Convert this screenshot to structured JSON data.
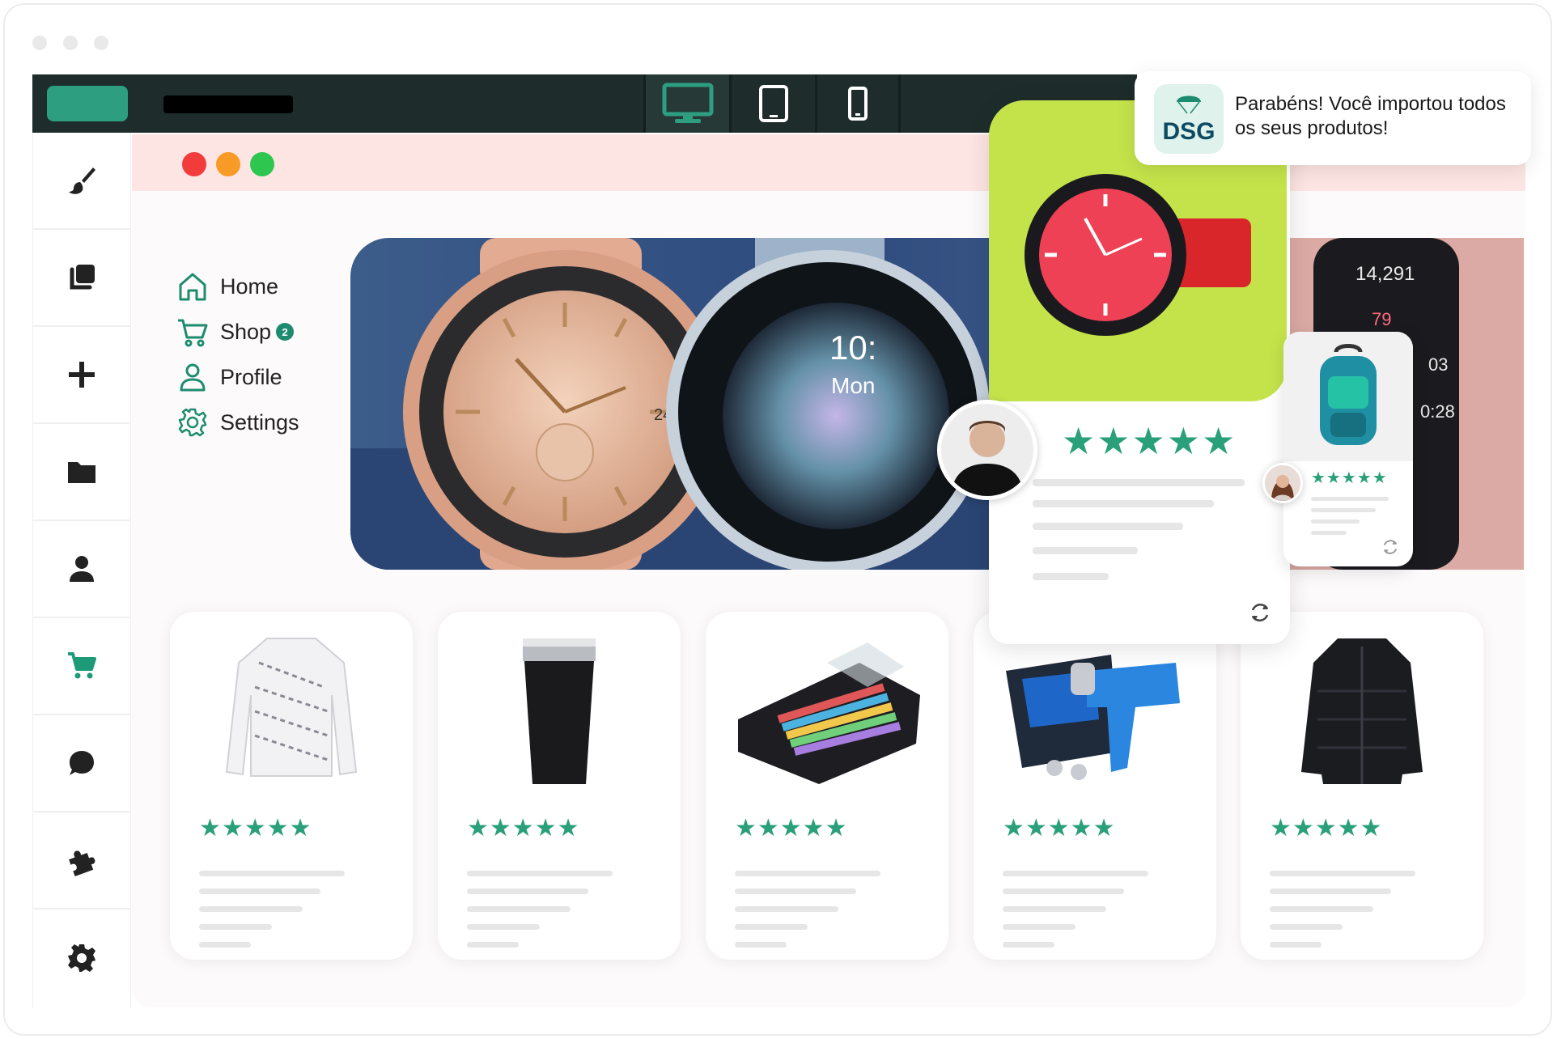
{
  "toolbar": {
    "devices": [
      "desktop",
      "tablet",
      "mobile"
    ],
    "active_device": "desktop",
    "accent": "#2e9e80"
  },
  "sidebar": {
    "items": [
      {
        "icon": "brush-icon"
      },
      {
        "icon": "copy-icon"
      },
      {
        "icon": "plus-icon"
      },
      {
        "icon": "folder-icon"
      },
      {
        "icon": "person-icon"
      },
      {
        "icon": "cart-icon",
        "active": true
      },
      {
        "icon": "chat-icon"
      },
      {
        "icon": "puzzle-icon"
      },
      {
        "icon": "gear-icon"
      }
    ]
  },
  "store_nav": {
    "home": "Home",
    "shop": "Shop",
    "shop_badge": "2",
    "profile": "Profile",
    "settings": "Settings"
  },
  "hero": {
    "watch_subdial": "24",
    "watch_time": "10:",
    "watch_day": "Mon",
    "steps": "14,291",
    "heart": "79",
    "stat3": "03",
    "stat4": "0:28"
  },
  "review_card": {
    "stars": "★★★★★"
  },
  "mini_card": {
    "stars": "★★★★★"
  },
  "products": [
    {
      "name": "long-sleeve-shirt",
      "stars": "★★★★★"
    },
    {
      "name": "tumbler",
      "stars": "★★★★★"
    },
    {
      "name": "card-wallet",
      "stars": "★★★★★"
    },
    {
      "name": "heat-gun-kit",
      "stars": "★★★★★"
    },
    {
      "name": "puffer-jacket",
      "stars": "★★★★★"
    }
  ],
  "toast": {
    "logo": "DSG",
    "message": "Parabéns! Você importou todos os seus produtos!"
  }
}
